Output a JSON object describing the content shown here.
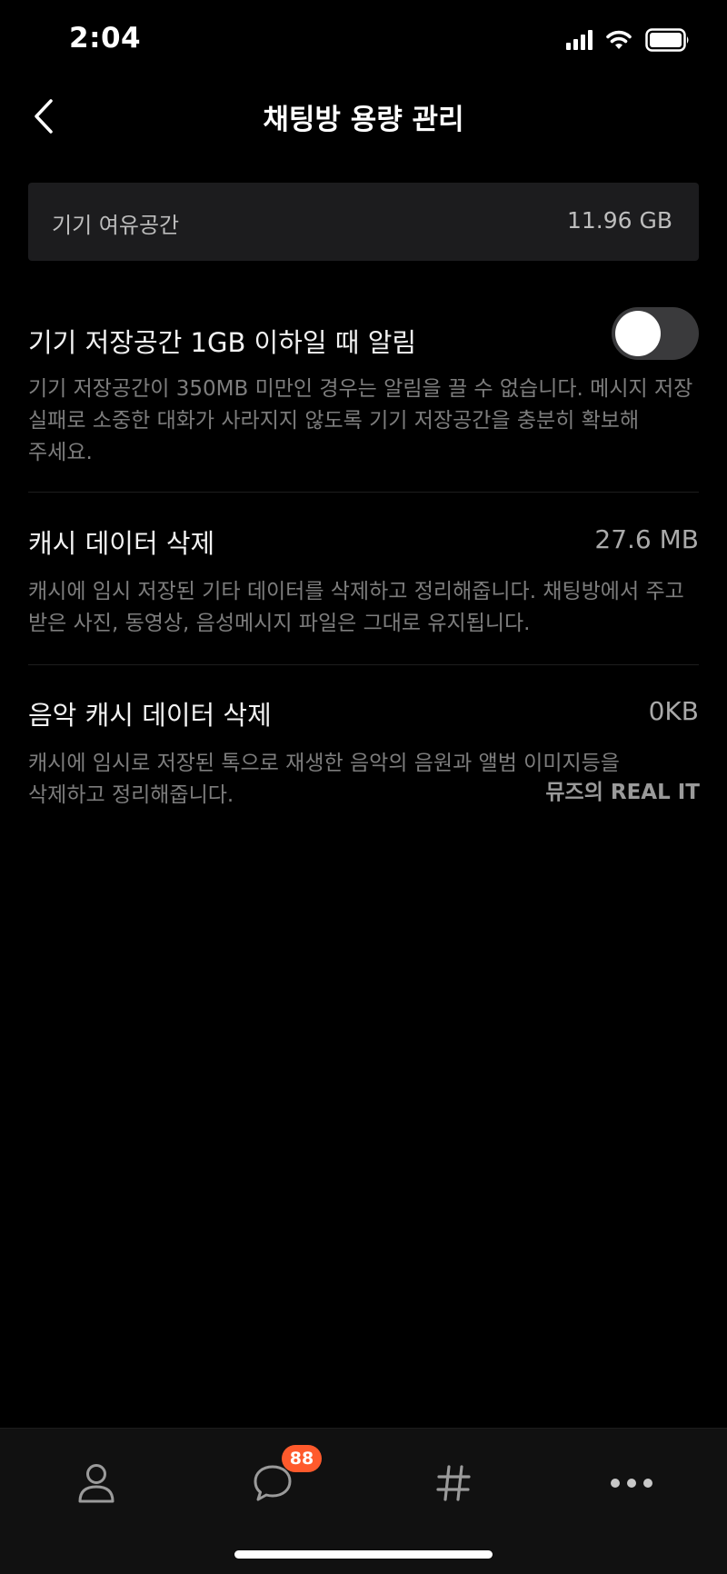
{
  "status_bar": {
    "time": "2:04"
  },
  "header": {
    "title": "채팅방 용량 관리"
  },
  "free_space": {
    "label": "기기 여유공간",
    "value": "11.96 GB"
  },
  "low_storage_alert": {
    "title": "기기 저장공간 1GB 이하일 때 알림",
    "enabled": false,
    "description": "기기 저장공간이 350MB 미만인 경우는 알림을 끌 수 없습니다. 메시지 저장 실패로 소중한 대화가 사라지지 않도록 기기 저장공간을 충분히 확보해 주세요."
  },
  "cache_data": {
    "title": "캐시 데이터 삭제",
    "value": "27.6 MB",
    "description": "캐시에 임시 저장된 기타 데이터를 삭제하고 정리해줍니다. 채팅방에서 주고 받은 사진, 동영상, 음성메시지 파일은 그대로 유지됩니다."
  },
  "music_cache": {
    "title": "음악 캐시 데이터 삭제",
    "value": "0KB",
    "description": "캐시에 임시로 저장된 톡으로 재생한 음악의 음원과 앨범 이미지등을 삭제하고 정리해줍니다."
  },
  "watermark": "뮤즈의 REAL IT",
  "tab_bar": {
    "chat_badge": "88",
    "icons": [
      "person-icon",
      "chat-bubble-icon",
      "hashtag-icon",
      "more-dots-icon"
    ]
  },
  "colors": {
    "background": "#000000",
    "card": "#1c1c1e",
    "badge": "#ff5a2c",
    "toggle_off": "#3a3a3c"
  }
}
